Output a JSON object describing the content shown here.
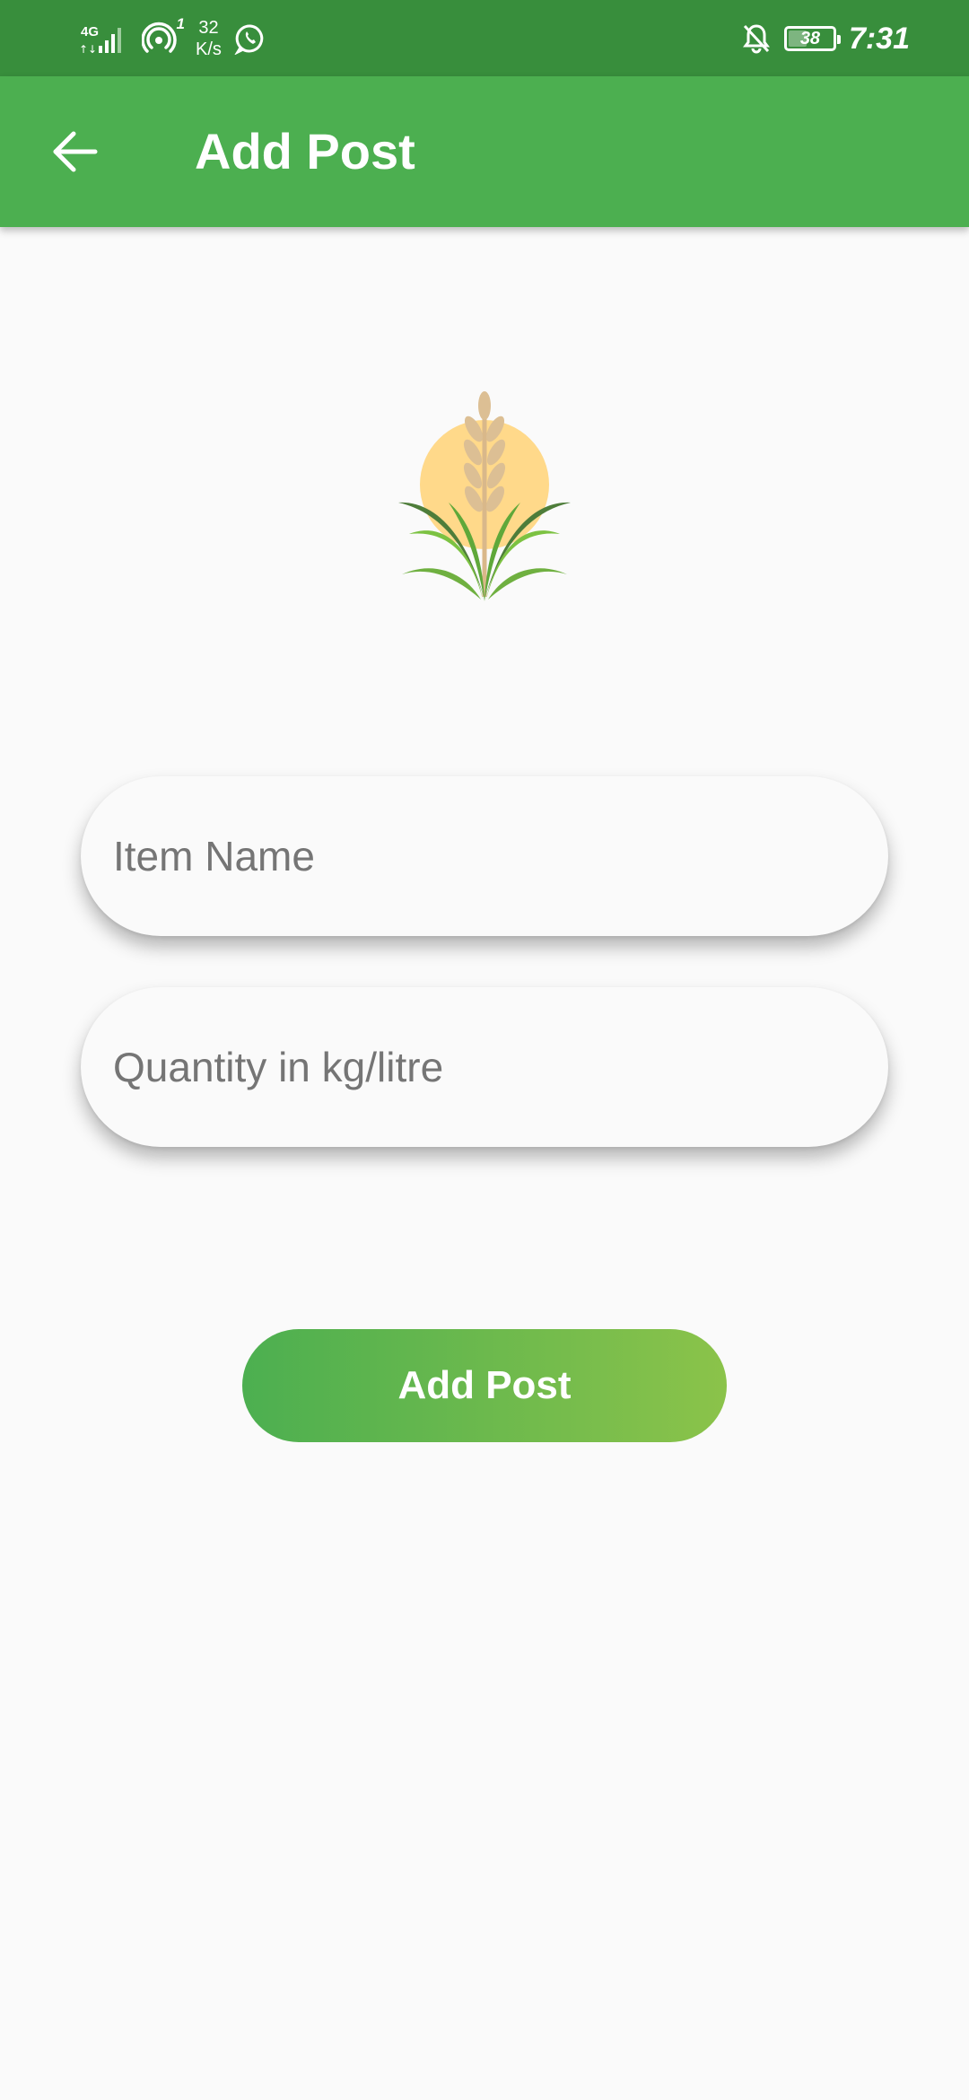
{
  "status_bar": {
    "network_type": "4G",
    "hotspot_count": "1",
    "speed_value": "32",
    "speed_unit": "K/s",
    "battery_level": "38",
    "battery_fraction": 0.38,
    "time": "7:31",
    "icons": [
      "signal-icon",
      "hotspot-icon",
      "whatsapp-icon",
      "notifications-off-icon",
      "battery-icon"
    ]
  },
  "app_bar": {
    "title": "Add Post",
    "back_icon": "arrow-back-icon",
    "color": "#4caf50"
  },
  "logo": {
    "icon": "wheat-plant-logo"
  },
  "form": {
    "item_name_placeholder": "Item Name",
    "item_name_value": "",
    "quantity_placeholder": "Quantity in kg/litre",
    "quantity_value": ""
  },
  "submit": {
    "label": "Add Post",
    "gradient_start": "#4caf50",
    "gradient_end": "#8bc34a"
  }
}
